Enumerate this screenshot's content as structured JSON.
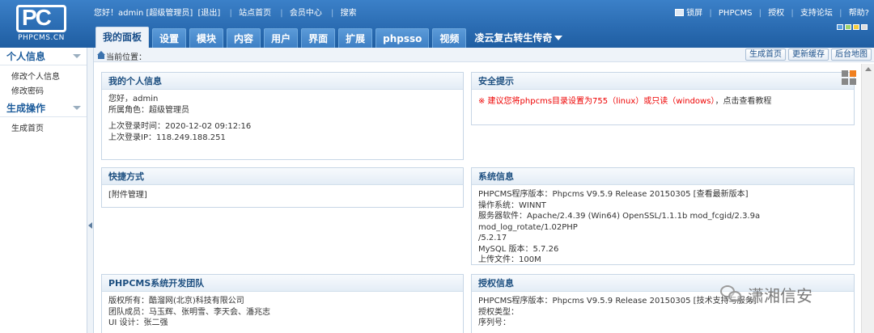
{
  "header": {
    "logo_mark": "PC",
    "logo_site": "PHPCMS.CN",
    "greeting": "您好！admin [超级管理员]",
    "logout": "[退出]",
    "links": [
      "站点首页",
      "会员中心",
      "搜索"
    ],
    "right_links": [
      "锁屏",
      "PHPCMS",
      "授权",
      "支持论坛",
      "帮助?"
    ],
    "skin_colors": [
      "#5aa0e0",
      "#9fd36b",
      "#f4cc3e",
      "#dddddd"
    ]
  },
  "tabs": [
    {
      "label": "我的面板",
      "active": true
    },
    {
      "label": "设置"
    },
    {
      "label": "模块"
    },
    {
      "label": "内容"
    },
    {
      "label": "用户"
    },
    {
      "label": "界面"
    },
    {
      "label": "扩展"
    },
    {
      "label": "phpsso"
    },
    {
      "label": "视频"
    }
  ],
  "site_selector": "凌云复古转生传奇",
  "sidebar": {
    "sections": [
      {
        "title": "个人信息",
        "items": [
          "修改个人信息",
          "修改密码"
        ]
      },
      {
        "title": "生成操作",
        "items": [
          "生成首页"
        ]
      }
    ]
  },
  "breadcrumb": "当前位置：",
  "actions": [
    "生成首页",
    "更新缓存",
    "后台地图"
  ],
  "panels": {
    "my_info": {
      "title": "我的个人信息",
      "line1": "您好，admin",
      "line2": "所属角色：超级管理员",
      "line3": "上次登录时间：2020-12-02 09:12:16",
      "line4": "上次登录IP：118.249.188.251"
    },
    "security": {
      "title": "安全提示",
      "warning": "※ 建议您将phpcms目录设置为755（linux）或只读（windows）",
      "link": "，点击查看教程"
    },
    "shortcuts": {
      "title": "快捷方式",
      "item": "[附件管理]"
    },
    "system": {
      "title": "系统信息",
      "version": "PHPCMS程序版本：Phpcms V9.5.9 Release 20150305 [查看最新版本]",
      "os": "操作系统：WINNT",
      "server": "服务器软件：Apache/2.4.39 (Win64) OpenSSL/1.1.1b mod_fcgid/2.3.9a mod_log_rotate/1.02PHP",
      "server_cont": "/5.2.17",
      "mysql": "MySQL 版本：5.7.26",
      "upload": "上传文件：100M"
    },
    "team": {
      "title": "PHPCMS系统开发团队",
      "copyright": "版权所有：酷溜网(北京)科技有限公司",
      "members": "团队成员：马玉辉、张明雪、李天会、潘兆志",
      "ui": "UI 设计：张二强"
    },
    "license": {
      "title": "授权信息",
      "version": "PHPCMS程序版本：Phpcms V9.5.9 Release 20150305 [技术支持与服务]",
      "type": "授权类型：",
      "serial": "序列号："
    }
  },
  "watermark": "潇湘信安"
}
